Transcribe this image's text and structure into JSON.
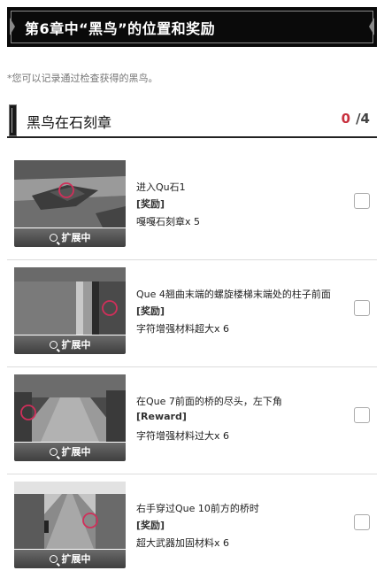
{
  "header": {
    "title": "第6章中“黑鸟”的位置和奖励"
  },
  "note": "*您可以记录通过检查获得的黑鸟。",
  "section": {
    "title": "黑鸟在石刻章",
    "collected": "0",
    "total": "/4"
  },
  "expand_label": "扩展中",
  "entries": [
    {
      "location": "进入Qu石1",
      "reward_tag": "[奖励]",
      "reward": "嘎嘎石刻章x 5"
    },
    {
      "location": "Que 4翘曲末端的螺旋楼梯末端处的柱子前面",
      "reward_tag": "[奖励]",
      "reward": "字符增强材料超大x 6"
    },
    {
      "location": "在Que 7前面的桥的尽头，左下角",
      "reward_tag": "[Reward]",
      "reward": "字符增强材料过大x 6"
    },
    {
      "location": "右手穿过Que 10前方的桥时",
      "reward_tag": "[奖励]",
      "reward": "超大武器加固材料x 6"
    }
  ],
  "colors": {
    "marker_circle": "#d02f5a",
    "accent_count": "#c8303e"
  }
}
